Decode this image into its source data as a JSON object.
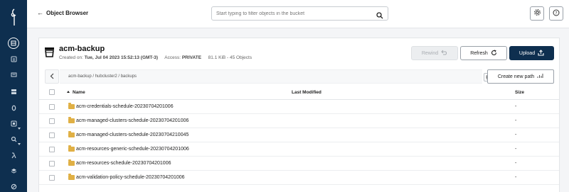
{
  "topbar": {
    "back_label": "Object Browser",
    "search_placeholder": "Start typing to filter objects in the bucket"
  },
  "sidebar": {
    "items": [
      {
        "icon": "buckets-icon",
        "active": true
      },
      {
        "icon": "policies-icon"
      },
      {
        "icon": "identity-icon"
      },
      {
        "icon": "monitoring-icon"
      },
      {
        "icon": "notifications-icon"
      },
      {
        "icon": "tiers-icon",
        "expandable": true
      },
      {
        "icon": "site-replication-icon",
        "expandable": true
      },
      {
        "icon": "lambda-icon"
      },
      {
        "icon": "support-icon"
      },
      {
        "icon": "license-icon"
      }
    ]
  },
  "bucket": {
    "name": "acm-backup",
    "created_label": "Created on:",
    "created_value": "Tue, Jul 04 2023 15:52:13 (GMT-3)",
    "access_label": "Access:",
    "access_value": "PRIVATE",
    "usage": "81.1 KiB - 45 Objects"
  },
  "actions": {
    "rewind": "Rewind",
    "refresh": "Refresh",
    "upload": "Upload"
  },
  "path": {
    "breadcrumb": "acm-backup / hubcluster2 / backups",
    "create_new_path": "Create new path"
  },
  "table": {
    "columns": {
      "name": "Name",
      "last_modified": "Last Modified",
      "size": "Size"
    },
    "rows": [
      {
        "name": "acm-credentials-schedule-20230704201006",
        "last_modified": "",
        "size": "-"
      },
      {
        "name": "acm-managed-clusters-schedule-20230704201006",
        "last_modified": "",
        "size": "-"
      },
      {
        "name": "acm-managed-clusters-schedule-20230704210045",
        "last_modified": "",
        "size": "-"
      },
      {
        "name": "acm-resources-generic-schedule-20230704201006",
        "last_modified": "",
        "size": "-"
      },
      {
        "name": "acm-resources-schedule-20230704201006",
        "last_modified": "",
        "size": "-"
      },
      {
        "name": "acm-validation-policy-schedule-20230704201006",
        "last_modified": "",
        "size": "-"
      }
    ]
  },
  "colors": {
    "sidebar_bg": "#0e2f4f",
    "primary_button": "#0e2f4f",
    "folder": "#e0b045"
  }
}
